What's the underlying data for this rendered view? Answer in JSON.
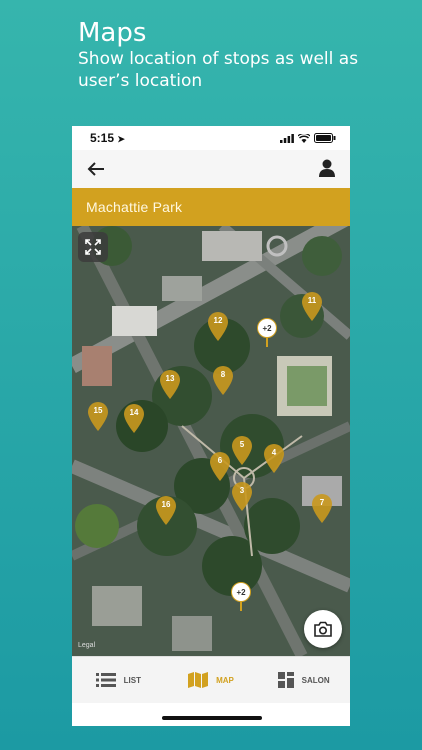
{
  "promo": {
    "title": "Maps",
    "subtitle": "Show location of stops as well as user’s location"
  },
  "status_bar": {
    "time": "5:15"
  },
  "header": {
    "title": "Machattie Park"
  },
  "map": {
    "pins": [
      {
        "label": "12"
      },
      {
        "label": "11"
      },
      {
        "label": "13"
      },
      {
        "label": "8"
      },
      {
        "label": "15"
      },
      {
        "label": "14"
      },
      {
        "label": "5"
      },
      {
        "label": "4"
      },
      {
        "label": "6"
      },
      {
        "label": "3"
      },
      {
        "label": "16"
      },
      {
        "label": "7"
      }
    ],
    "clusters": [
      {
        "label": "+2"
      },
      {
        "label": "+2"
      }
    ],
    "legal": "Legal"
  },
  "tabs": [
    {
      "label": "LIST",
      "icon": "list-icon",
      "active": false
    },
    {
      "label": "MAP",
      "icon": "map-icon",
      "active": true
    },
    {
      "label": "SALON",
      "icon": "grid-icon",
      "active": false
    }
  ],
  "colors": {
    "accent": "#d2a11f",
    "background": "#2aa8a8"
  }
}
